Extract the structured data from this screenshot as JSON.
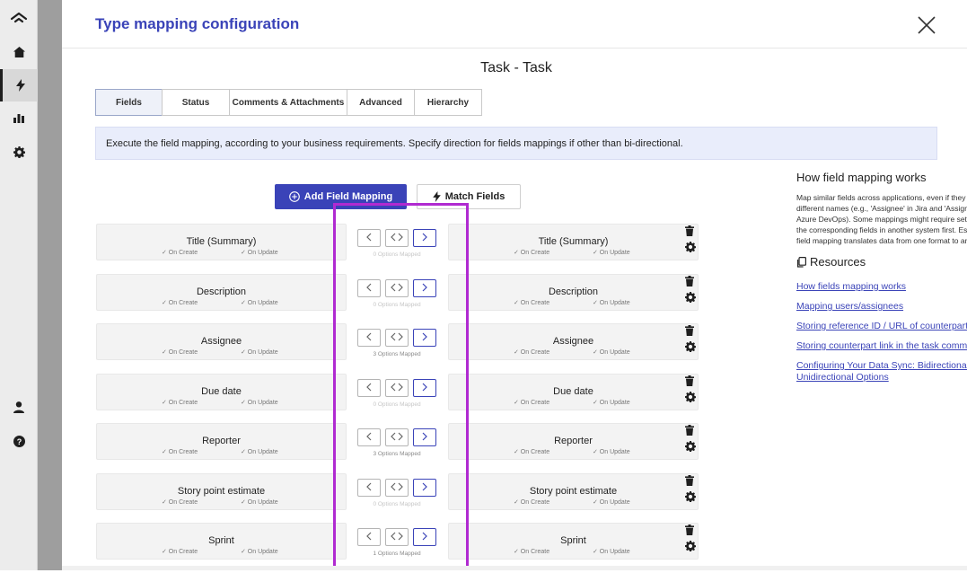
{
  "modal": {
    "title": "Type mapping configuration",
    "subtitle": "Task - Task"
  },
  "tabs": [
    {
      "label": "Fields",
      "active": true
    },
    {
      "label": "Status",
      "active": false
    },
    {
      "label": "Comments & Attachments",
      "active": false
    },
    {
      "label": "Advanced",
      "active": false
    },
    {
      "label": "Hierarchy",
      "active": false
    }
  ],
  "info": "Execute the field mapping, according to your business requirements. Specify direction for fields mappings if other than bi-directional.",
  "actions": {
    "add_label": "Add Field Mapping",
    "match_label": "Match Fields"
  },
  "meta_labels": {
    "on_create": "✓ On Create",
    "on_update": "✓ On Update"
  },
  "rows": [
    {
      "left": "Title (Summary)",
      "right": "Title (Summary)",
      "options": "0 Options Mapped"
    },
    {
      "left": "Description",
      "right": "Description",
      "options": "0 Options Mapped"
    },
    {
      "left": "Assignee",
      "right": "Assignee",
      "options": "3 Options Mapped"
    },
    {
      "left": "Due date",
      "right": "Due date",
      "options": "0 Options Mapped"
    },
    {
      "left": "Reporter",
      "right": "Reporter",
      "options": "3 Options Mapped"
    },
    {
      "left": "Story point estimate",
      "right": "Story point estimate",
      "options": "0 Options Mapped"
    },
    {
      "left": "Sprint",
      "right": "Sprint",
      "options": "1 Options Mapped"
    }
  ],
  "side": {
    "title": "How field mapping works",
    "text": "Map similar fields across applications, even if they have different names (e.g., 'Assignee' in Jira and 'Assigned To' in Azure DevOps). Some mappings might require setting up the corresponding fields in another system first. Essentially, field mapping translates data from one format to another.",
    "resources_title": "Resources",
    "links": [
      "How fields mapping works",
      "Mapping users/assignees",
      "Storing reference ID / URL of counterpart",
      "Storing counterpart link in the task comment",
      "Configuring Your Data Sync: Bidirectional and Unidirectional Options"
    ]
  },
  "colors": {
    "accent": "#3a43b8",
    "highlight": "#b02ad1",
    "info_bg": "#e9edfb"
  }
}
